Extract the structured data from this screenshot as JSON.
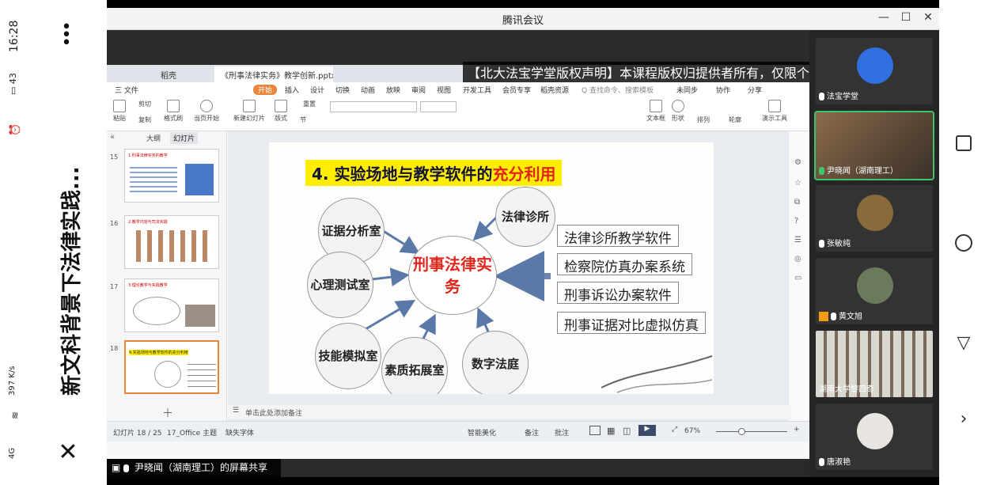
{
  "phone": {
    "time": "16:28",
    "battery": "43",
    "net_speed": "397",
    "net_unit": "K/s",
    "signal": "4G",
    "page_title": "新文科背景下法律实践..."
  },
  "window": {
    "title": "腾讯会议"
  },
  "share": {
    "notice": "【北大法宝学堂版权声明】本课程版权归提供者所有，仅限个人学习，严禁任",
    "doc_tab": "《刑事法律实务》教学创新.pptx",
    "home_tab": "稻壳",
    "menu": [
      "三 文件",
      "开始",
      "插入",
      "设计",
      "切换",
      "动画",
      "放映",
      "审阅",
      "视图",
      "开发工具",
      "会员专享",
      "稻壳资源",
      "Q 查找命令、搜索模板",
      "未同步",
      "协作",
      "分享"
    ],
    "ribbon": [
      "粘贴",
      "剪切",
      "复制",
      "格式刷",
      "当页开始",
      "新建幻灯片",
      "版式",
      "节",
      "重置",
      "文本框",
      "形状",
      "排列",
      "轮廓",
      "演示工具"
    ],
    "thumb_tabs": [
      "大纲",
      "幻灯片"
    ],
    "thumbs": [
      {
        "num": "15",
        "title": "1.刑事法律实务的教学"
      },
      {
        "num": "16",
        "title": "2.教学内容与司法实践"
      },
      {
        "num": "17",
        "title": "3.理论教学与实践教学"
      },
      {
        "num": "18",
        "title": "4.实验场地与教学软件的充分利用"
      }
    ],
    "notes_placeholder": "单击此处添加备注",
    "status_slide": "幻灯片 18 / 25",
    "status_theme": "17_Office 主题",
    "status_font": "缺失字体",
    "status_beautify": "智能美化",
    "status_notes": "备注",
    "status_comment": "批注",
    "zoom": "67%",
    "screen_owner": "尹晓闻（湖南理工）的屏幕共享"
  },
  "slide": {
    "title_prefix": "4. 实验场地与教学软件的",
    "title_highlight": "充分利用",
    "center": "刑事法律实务",
    "nodes": [
      "证据分析室",
      "法律诊所",
      "心理测试室",
      "技能模拟室",
      "素质拓展室",
      "数字法庭"
    ],
    "software": [
      "法律诊所教学软件",
      "检察院仿真办案系统",
      "刑事诉讼办案软件",
      "刑事证据对比虚拟仿真"
    ]
  },
  "participants": [
    {
      "name": "法宝学堂",
      "kind": "logo"
    },
    {
      "name": "尹晓闻（湖南理工）",
      "kind": "video"
    },
    {
      "name": "张敏纯",
      "kind": "avatar"
    },
    {
      "name": "黄文旭",
      "kind": "avatar"
    },
    {
      "name": "湖南大学黎四奇",
      "kind": "video"
    },
    {
      "name": "唐淑艳",
      "kind": "avatar"
    }
  ],
  "colors": {
    "title_yellow": "#ffee00",
    "accent_red": "#e1251b",
    "active_green": "#3ec46d",
    "wps_orange": "#e9863a"
  }
}
